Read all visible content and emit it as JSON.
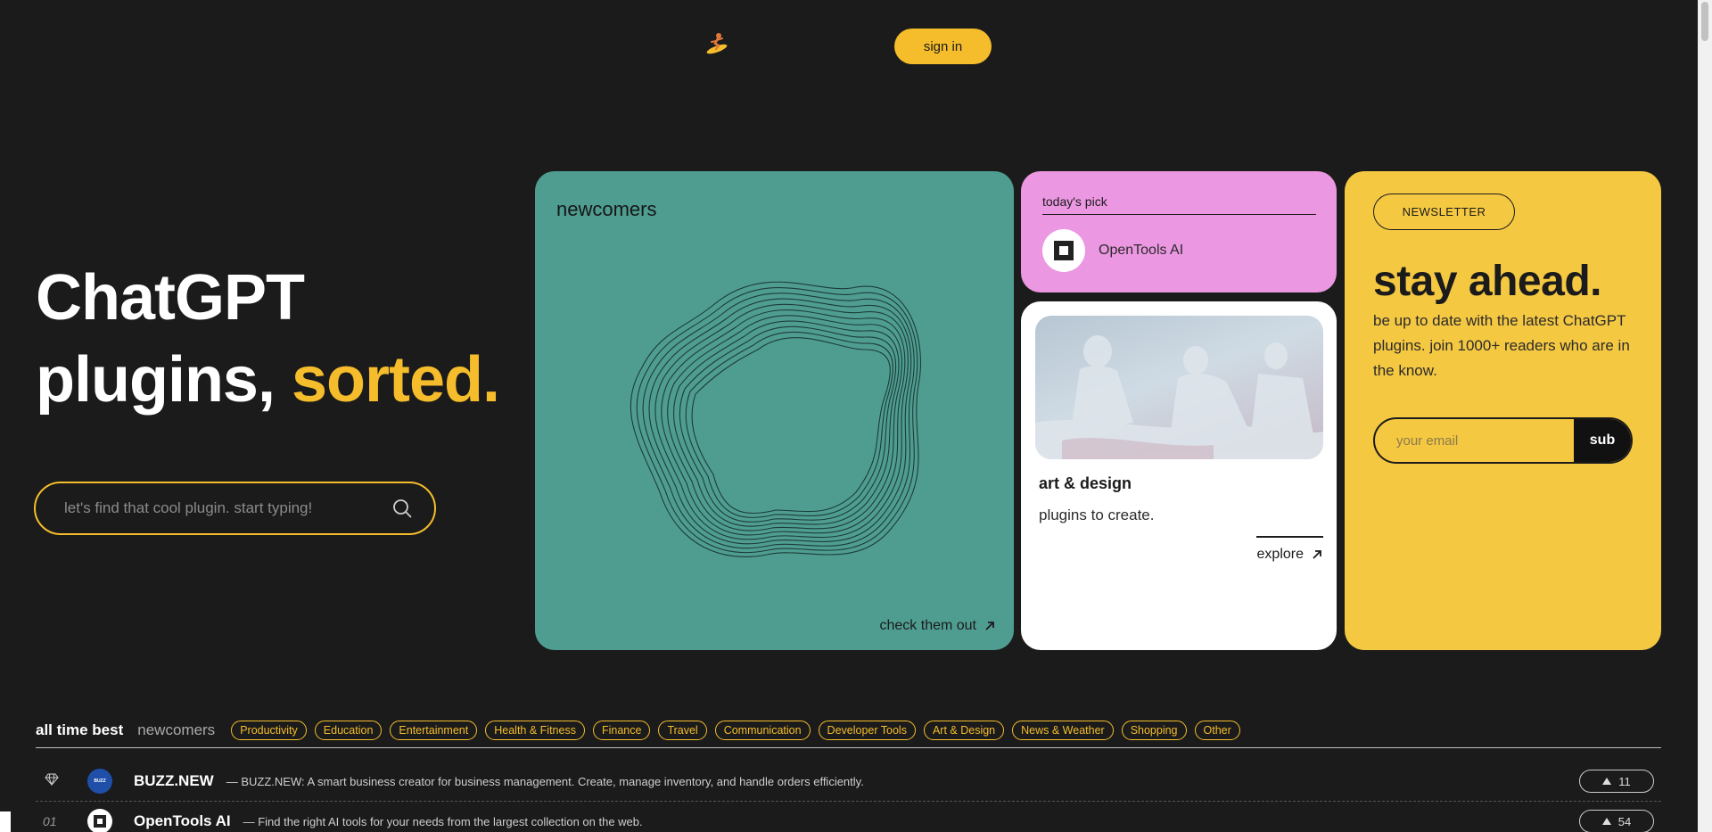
{
  "header": {
    "sign_in_label": "sign in"
  },
  "hero": {
    "title_line1": "ChatGPT",
    "title_line2_white": "plugins, ",
    "title_line2_accent": "sorted.",
    "search_placeholder": "let's find that cool plugin. start typing!"
  },
  "cards": {
    "newcomers": {
      "title": "newcomers",
      "link_label": "check them out"
    },
    "todays_pick": {
      "label": "today's pick",
      "plugin_name": "OpenTools AI"
    },
    "art_design": {
      "title": "art & design",
      "subtitle": "plugins to create.",
      "link_label": "explore"
    },
    "newsletter": {
      "badge": "NEWSLETTER",
      "title": "stay ahead.",
      "text": "be up to date with the latest ChatGPT plugins. join 1000+ readers who are in the know.",
      "email_placeholder": "your email",
      "submit_label": "sub"
    }
  },
  "filters": {
    "tab_active": "all time best",
    "tab_newcomers": "newcomers",
    "categories": [
      "Productivity",
      "Education",
      "Entertainment",
      "Health & Fitness",
      "Finance",
      "Travel",
      "Communication",
      "Developer Tools",
      "Art & Design",
      "News & Weather",
      "Shopping",
      "Other"
    ]
  },
  "plugins": [
    {
      "rank": "",
      "rank_icon": "diamond-icon",
      "name": "BUZZ.NEW",
      "description": "— BUZZ.NEW: A smart business creator for business management. Create, manage inventory, and handle orders efficiently.",
      "votes": "11"
    },
    {
      "rank": "01",
      "name": "OpenTools AI",
      "description": "— Find the right AI tools for your needs from the largest collection on the web.",
      "votes": "54"
    }
  ],
  "colors": {
    "background": "#1b1b1b",
    "accent": "#f5bd2b",
    "newcomers_card": "#4f9d91",
    "pick_card": "#ec97e2",
    "newsletter_card": "#f5c842"
  }
}
